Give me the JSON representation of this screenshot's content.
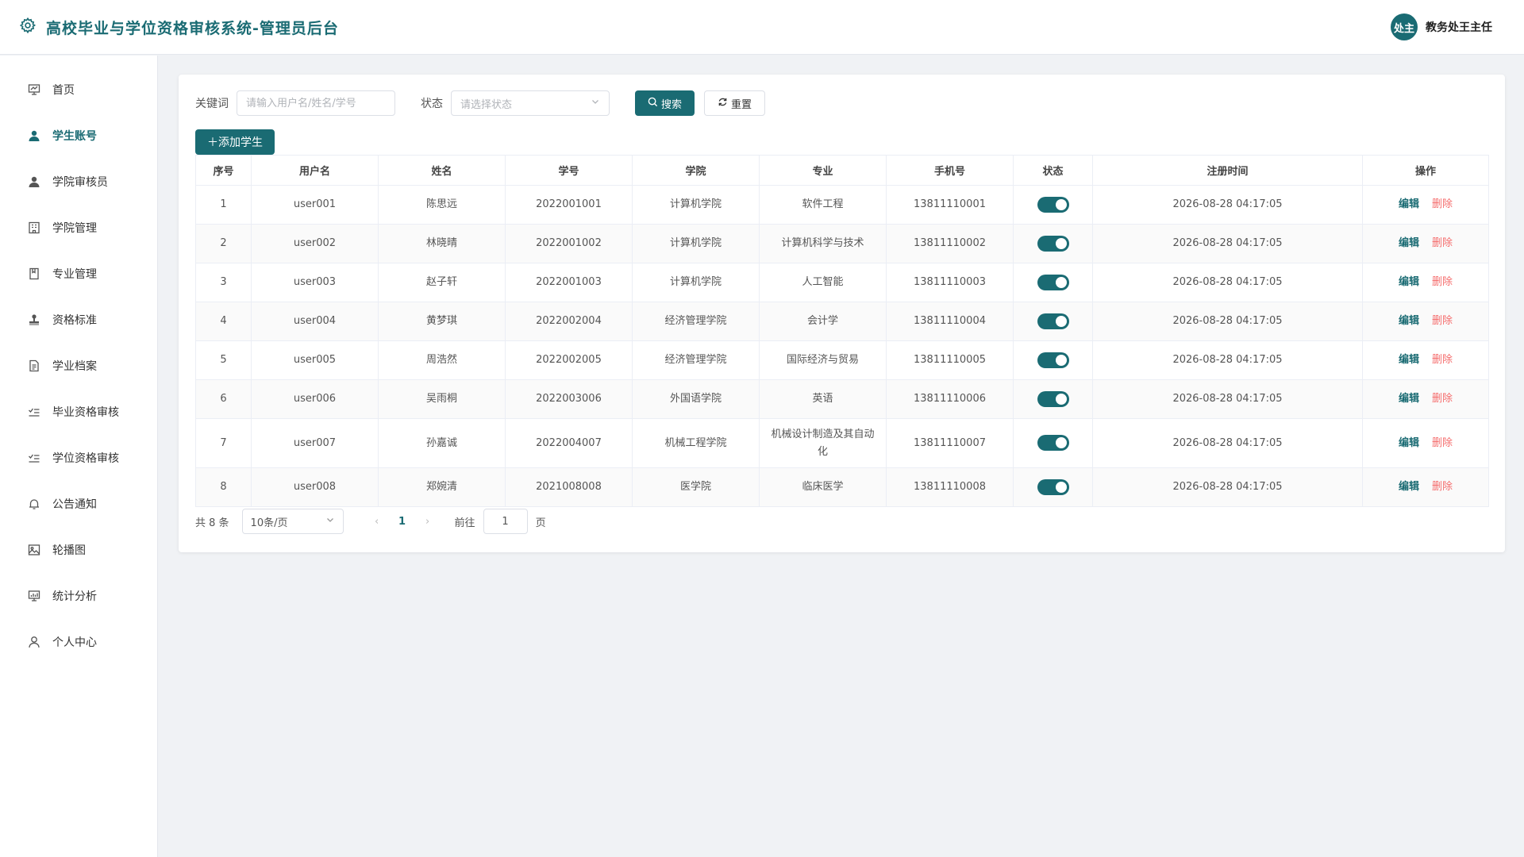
{
  "header": {
    "title": "高校毕业与学位资格审核系统-管理员后台",
    "user_avatar_text": "处主",
    "user_name": "教务处王主任"
  },
  "sidebar": {
    "items": [
      {
        "label": "首页",
        "icon": "presentation-icon"
      },
      {
        "label": "学生账号",
        "icon": "user-solid-icon",
        "active": true
      },
      {
        "label": "学院审核员",
        "icon": "user-solid-icon"
      },
      {
        "label": "学院管理",
        "icon": "office-building-icon"
      },
      {
        "label": "专业管理",
        "icon": "notebook-icon"
      },
      {
        "label": "资格标准",
        "icon": "stamp-icon"
      },
      {
        "label": "学业档案",
        "icon": "document-icon"
      },
      {
        "label": "毕业资格审核",
        "icon": "check-list-icon"
      },
      {
        "label": "学位资格审核",
        "icon": "check-list-icon"
      },
      {
        "label": "公告通知",
        "icon": "bell-icon"
      },
      {
        "label": "轮播图",
        "icon": "picture-icon"
      },
      {
        "label": "统计分析",
        "icon": "data-board-icon"
      },
      {
        "label": "个人中心",
        "icon": "user-icon"
      }
    ]
  },
  "filter": {
    "keyword_label": "关键词",
    "keyword_placeholder": "请输入用户名/姓名/学号",
    "status_label": "状态",
    "status_placeholder": "请选择状态",
    "search_label": "搜索",
    "reset_label": "重置"
  },
  "add_button_label": "添加学生",
  "table": {
    "headers": [
      "序号",
      "用户名",
      "姓名",
      "学号",
      "学院",
      "专业",
      "手机号",
      "状态",
      "注册时间",
      "操作"
    ],
    "edit_label": "编辑",
    "delete_label": "删除",
    "rows": [
      {
        "index": "1",
        "username": "user001",
        "name": "陈思远",
        "student_id": "2022001001",
        "college": "计算机学院",
        "major": "软件工程",
        "phone": "13811110001",
        "enabled": true,
        "registered": "2026-08-28 04:17:05"
      },
      {
        "index": "2",
        "username": "user002",
        "name": "林晓晴",
        "student_id": "2022001002",
        "college": "计算机学院",
        "major": "计算机科学与技术",
        "phone": "13811110002",
        "enabled": true,
        "registered": "2026-08-28 04:17:05"
      },
      {
        "index": "3",
        "username": "user003",
        "name": "赵子轩",
        "student_id": "2022001003",
        "college": "计算机学院",
        "major": "人工智能",
        "phone": "13811110003",
        "enabled": true,
        "registered": "2026-08-28 04:17:05"
      },
      {
        "index": "4",
        "username": "user004",
        "name": "黄梦琪",
        "student_id": "2022002004",
        "college": "经济管理学院",
        "major": "会计学",
        "phone": "13811110004",
        "enabled": true,
        "registered": "2026-08-28 04:17:05"
      },
      {
        "index": "5",
        "username": "user005",
        "name": "周浩然",
        "student_id": "2022002005",
        "college": "经济管理学院",
        "major": "国际经济与贸易",
        "phone": "13811110005",
        "enabled": true,
        "registered": "2026-08-28 04:17:05"
      },
      {
        "index": "6",
        "username": "user006",
        "name": "吴雨桐",
        "student_id": "2022003006",
        "college": "外国语学院",
        "major": "英语",
        "phone": "13811110006",
        "enabled": true,
        "registered": "2026-08-28 04:17:05"
      },
      {
        "index": "7",
        "username": "user007",
        "name": "孙嘉诚",
        "student_id": "2022004007",
        "college": "机械工程学院",
        "major": "机械设计制造及其自动化",
        "phone": "13811110007",
        "enabled": true,
        "registered": "2026-08-28 04:17:05"
      },
      {
        "index": "8",
        "username": "user008",
        "name": "郑婉清",
        "student_id": "2021008008",
        "college": "医学院",
        "major": "临床医学",
        "phone": "13811110008",
        "enabled": true,
        "registered": "2026-08-28 04:17:05"
      }
    ]
  },
  "pagination": {
    "total_text": "共 8 条",
    "page_size": "10条/页",
    "current_page": "1",
    "goto_label": "前往",
    "goto_value": "1",
    "page_suffix": "页"
  },
  "colors": {
    "primary": "#1a6b73",
    "danger": "#f56c6c"
  }
}
